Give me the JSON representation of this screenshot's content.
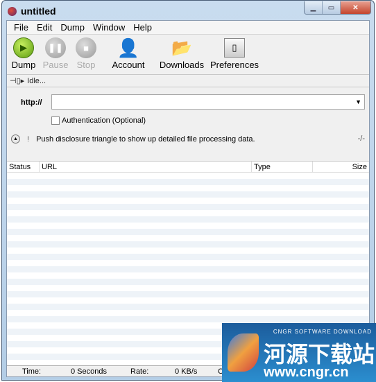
{
  "window": {
    "title": "untitled",
    "controls": [
      "minimize",
      "maximize",
      "close"
    ]
  },
  "menu": [
    "File",
    "Edit",
    "Dump",
    "Window",
    "Help"
  ],
  "toolbar": [
    {
      "label": "Dump",
      "icon": "play-icon",
      "enabled": true
    },
    {
      "label": "Pause",
      "icon": "pause-icon",
      "enabled": false
    },
    {
      "label": "Stop",
      "icon": "stop-icon",
      "enabled": false
    },
    {
      "label": "Account",
      "icon": "user-icon",
      "enabled": true
    },
    {
      "label": "Downloads",
      "icon": "folder-icon",
      "enabled": true
    },
    {
      "label": "Preferences",
      "icon": "switch-icon",
      "enabled": true
    }
  ],
  "status": {
    "text": "Idle..."
  },
  "form": {
    "url_label": "http://",
    "url_value": "",
    "auth_label": "Authentication (Optional)",
    "auth_checked": false
  },
  "disclosure": {
    "mark": "!",
    "text": "Push disclosure triangle to show up detailed file processing data.",
    "counter": "-/-"
  },
  "table": {
    "columns": [
      "Status",
      "URL",
      "Type",
      "",
      "Size"
    ]
  },
  "footer": {
    "time_label": "Time:",
    "time_value": "0 Seconds",
    "rate_label": "Rate:",
    "rate_value": "0  KB/s",
    "cut": "C"
  },
  "watermark": {
    "tag": "CNGR SOFTWARE DOWNLOAD",
    "name": "河源下载站",
    "url": "www.cngr.cn"
  }
}
